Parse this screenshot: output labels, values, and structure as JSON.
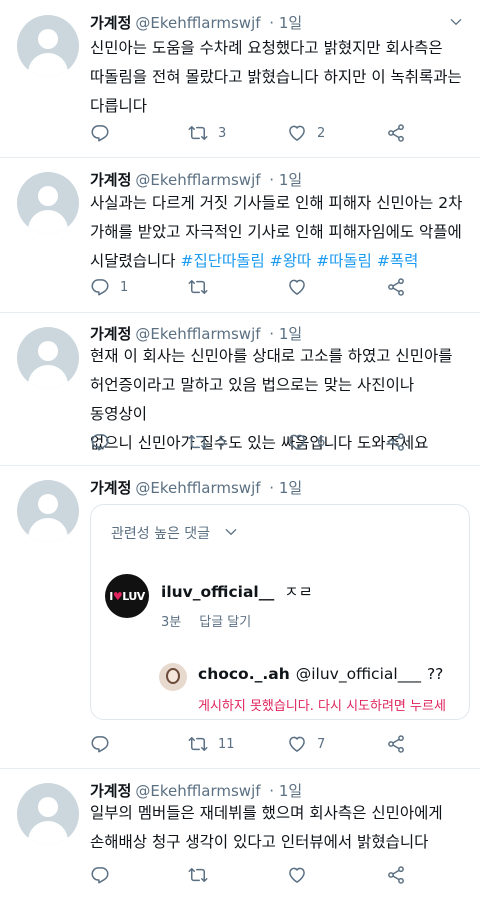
{
  "tweets": [
    {
      "name": "가계정",
      "handle": "@Ekehfflarmswjf",
      "time": "· 1일",
      "lines": [
        "신민아는 도움을 수차례 요청했다고 밝혔지만 회사측은",
        "따돌림을 전혀 몰랐다고 밝혔습니다 하지만 이 녹취록과는",
        "다릅니다"
      ],
      "replies": "",
      "retweets": "3",
      "likes": "2"
    },
    {
      "name": "가계정",
      "handle": "@Ekehfflarmswjf",
      "time": "· 1일",
      "lines": [
        "사실과는 다르게 거짓 기사들로 인해 피해자 신민아는 2차",
        "가해를 받았고 자극적인 기사로 인해 피해자임에도 악플에",
        "시달렸습니다 "
      ],
      "hashtags": "#집단따돌림 #왕따 #따돌림 #폭력",
      "replies": "1",
      "retweets": "",
      "likes": ""
    },
    {
      "name": "가계정",
      "handle": "@Ekehfflarmswjf",
      "time": "· 1일",
      "lines": [
        "현재 이 회사는 신민아를 상대로 고소를 하였고 신민아를",
        "허언증이라고 말하고 있음 법으로는 맞는 사진이나 동영상이",
        "없으니 신민아가 질수도 있는 싸움입니다 도와주세요"
      ],
      "replies": "",
      "retweets": "5",
      "likes": "6"
    },
    {
      "name": "가계정",
      "handle": "@Ekehfflarmswjf",
      "time": "· 1일",
      "replies": "",
      "retweets": "11",
      "likes": "7",
      "card": {
        "title": "관련성 높은 댓글",
        "logo_text_a": "I",
        "logo_text_b": "LUV",
        "reply_user": "iluv_official__",
        "reply_text": "ㅈㄹ",
        "reply_time": "3분",
        "reply_action": "답글 달기",
        "sub_user": "choco._.ah",
        "sub_mention": "@iluv_official___",
        "sub_text": "??",
        "error": "게시하지 못했습니다. 다시 시도하려면 누르세"
      }
    },
    {
      "name": "가계정",
      "handle": "@Ekehfflarmswjf",
      "time": "· 1일",
      "lines": [
        "일부의 멤버들은 재데뷔를 했으며 회사측은 신민아에게",
        "손해배상 청구 생각이 있다고 인터뷰에서 밝혔습니다"
      ],
      "replies": "",
      "retweets": "",
      "likes": ""
    }
  ],
  "icons": {
    "reply": "reply-icon",
    "retweet": "retweet-icon",
    "like": "heart-icon",
    "share": "share-icon",
    "more": "chevron-down-icon"
  },
  "colors": {
    "text": "#0f1419",
    "muted": "#5b7083",
    "hashtag": "#1d9bf0",
    "error": "#e0245e",
    "avatar": "#ccd6dd"
  }
}
